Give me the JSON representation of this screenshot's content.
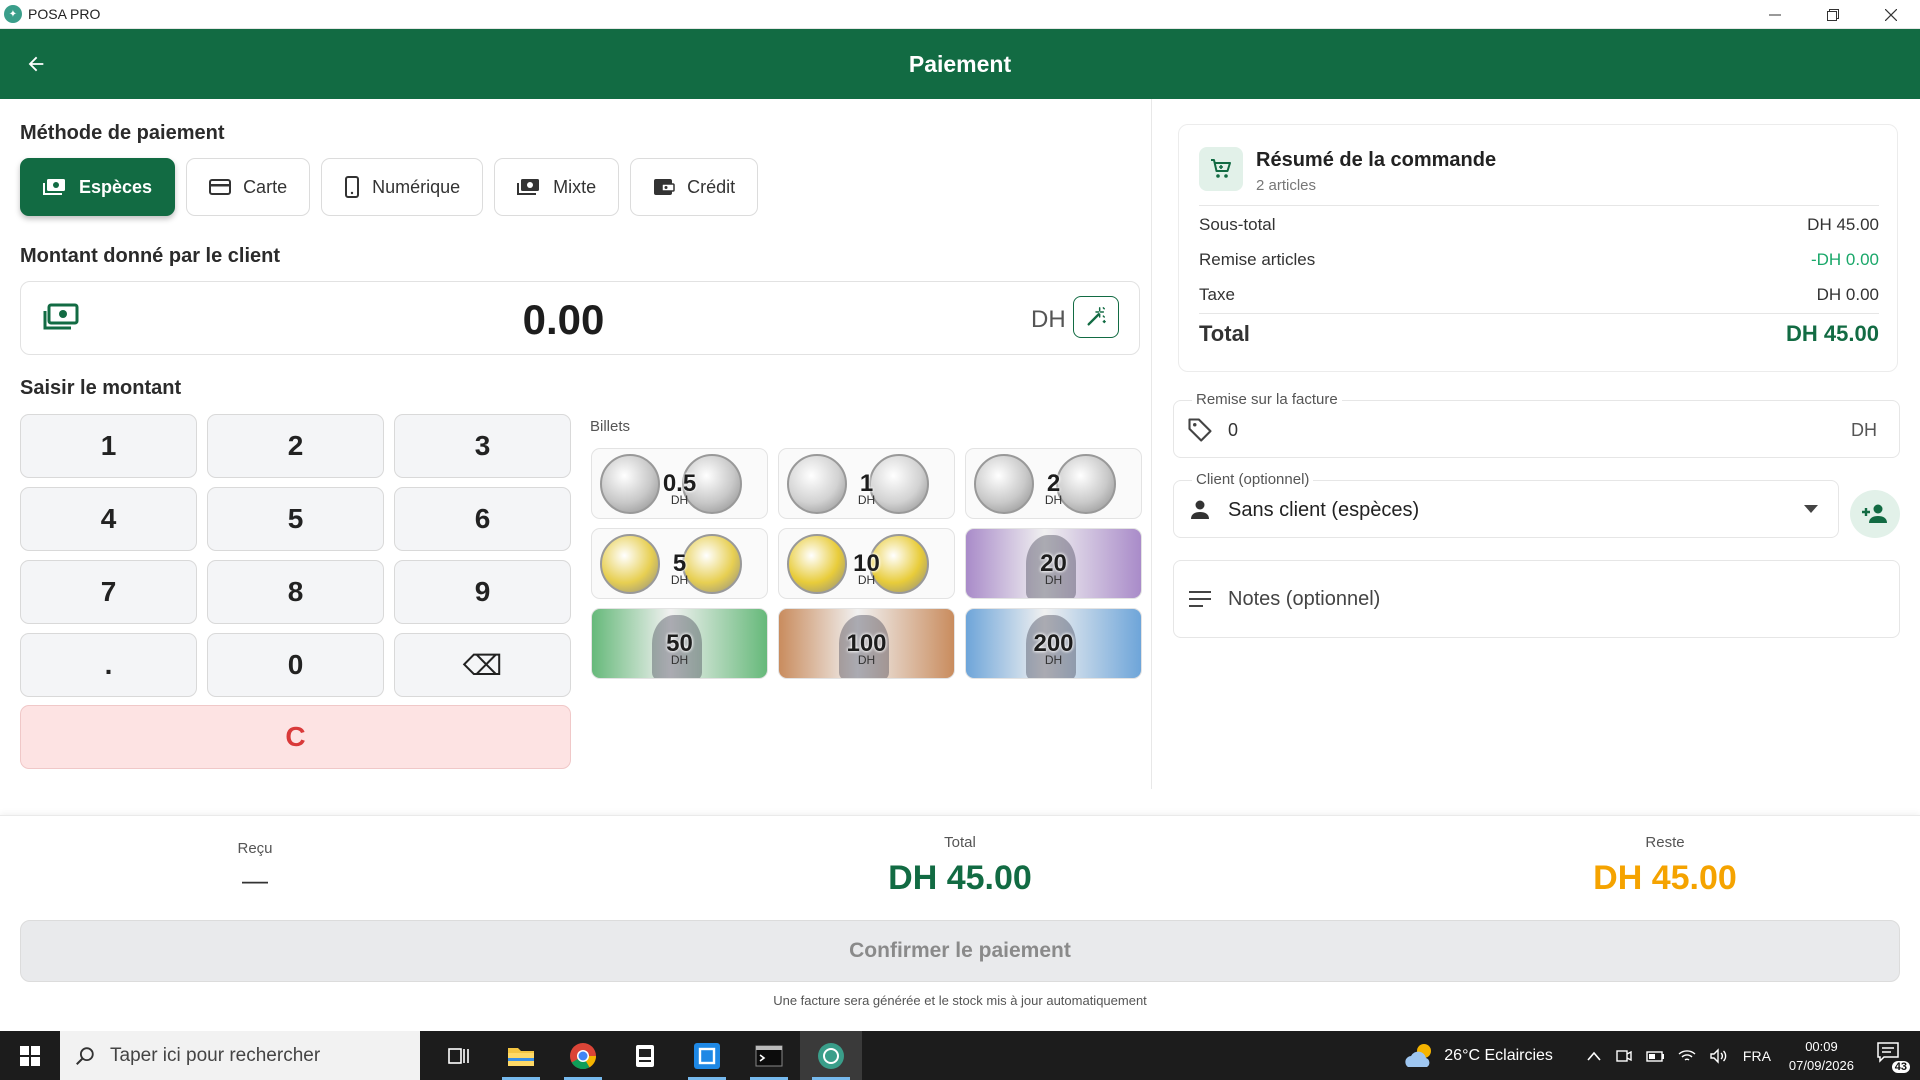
{
  "window": {
    "title": "POSA PRO"
  },
  "header": {
    "title": "Paiement"
  },
  "payment_method": {
    "title": "Méthode de paiement",
    "methods": [
      {
        "label": "Espèces",
        "icon": "cash-icon"
      },
      {
        "label": "Carte",
        "icon": "card-icon"
      },
      {
        "label": "Numérique",
        "icon": "phone-icon"
      },
      {
        "label": "Mixte",
        "icon": "mixed-icon"
      },
      {
        "label": "Crédit",
        "icon": "wallet-icon"
      }
    ],
    "selected": "Espèces"
  },
  "amount": {
    "title": "Montant donné par le client",
    "value": "0.00",
    "currency": "DH"
  },
  "keypad": {
    "title": "Saisir le montant",
    "keys": [
      "1",
      "2",
      "3",
      "4",
      "5",
      "6",
      "7",
      "8",
      "9",
      ".",
      "0",
      "⌫"
    ],
    "clear": "C"
  },
  "billets": {
    "title": "Billets",
    "items": [
      {
        "value": "0.5",
        "currency": "DH",
        "kind": "coin",
        "color": "#c8c8c8"
      },
      {
        "value": "1",
        "currency": "DH",
        "kind": "coin",
        "color": "#d2d2d2"
      },
      {
        "value": "2",
        "currency": "DH",
        "kind": "coin",
        "color": "#c9c9c9"
      },
      {
        "value": "5",
        "currency": "DH",
        "kind": "coin",
        "color": "#e7cf52"
      },
      {
        "value": "10",
        "currency": "DH",
        "kind": "coin",
        "color": "#e8cc3a"
      },
      {
        "value": "20",
        "currency": "DH",
        "kind": "note",
        "color": "#a98bc9"
      },
      {
        "value": "50",
        "currency": "DH",
        "kind": "note",
        "color": "#66b97a"
      },
      {
        "value": "100",
        "currency": "DH",
        "kind": "note",
        "color": "#c98c5e"
      },
      {
        "value": "200",
        "currency": "DH",
        "kind": "note",
        "color": "#6ea5d9"
      }
    ]
  },
  "summary": {
    "title": "Résumé de la commande",
    "subtitle": "2 articles",
    "rows": [
      {
        "label": "Sous-total",
        "value": "DH 45.00"
      },
      {
        "label": "Remise articles",
        "value": "-DH 0.00"
      },
      {
        "label": "Taxe",
        "value": "DH 0.00"
      }
    ],
    "total_label": "Total",
    "total_value": "DH 45.00"
  },
  "discount": {
    "label": "Remise sur la facture",
    "value": "0",
    "currency": "DH"
  },
  "client": {
    "label": "Client (optionnel)",
    "value": "Sans client (espèces)"
  },
  "notes": {
    "placeholder": "Notes (optionnel)"
  },
  "footer": {
    "recu_label": "Reçu",
    "recu_value": "—",
    "total_label": "Total",
    "total_value": "DH 45.00",
    "reste_label": "Reste",
    "reste_value": "DH 45.00",
    "confirm": "Confirmer le paiement",
    "note": "Une facture sera générée et le stock mis à jour automatiquement"
  },
  "taskbar": {
    "search_placeholder": "Taper ici pour rechercher",
    "weather": "26°C  Eclaircies",
    "lang": "FRA",
    "time": "00:09",
    "date": "07/09/2026",
    "notif_count": "43"
  },
  "colors": {
    "primary": "#126b43",
    "accent_orange": "#f5a300",
    "discount_green": "#1aa86a",
    "clear_red": "#d93a3a"
  }
}
